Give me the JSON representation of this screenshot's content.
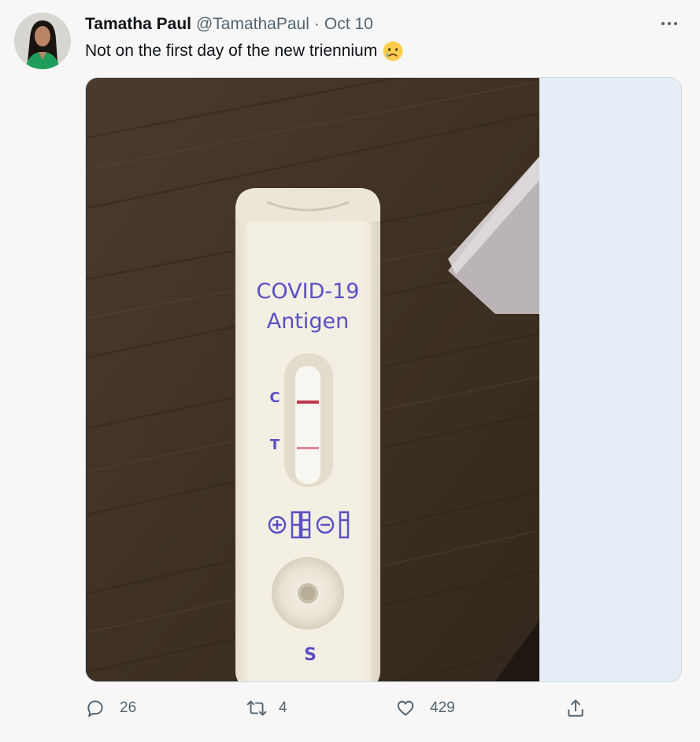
{
  "tweet": {
    "author_name": "Tamatha Paul",
    "handle": "@TamathaPaul",
    "separator": "·",
    "date": "Oct 10",
    "text": "Not on the first day of the new triennium",
    "emoji": "crying-face-emoji"
  },
  "media": {
    "test_label_line1": "COVID-19",
    "test_label_line2": "Antigen",
    "control_label": "C",
    "test_label": "T",
    "sample_label": "S"
  },
  "actions": {
    "replies": "26",
    "retweets": "4",
    "likes": "429"
  },
  "colors": {
    "handle_gray": "#536471",
    "test_text_purple": "#5b4fc4",
    "line_red": "#c2354a"
  }
}
